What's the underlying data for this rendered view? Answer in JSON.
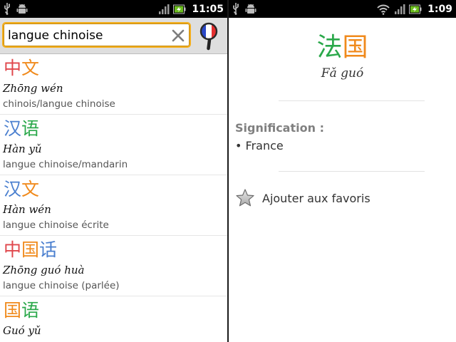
{
  "status_left": {
    "time": "11:05"
  },
  "status_right": {
    "time": "1:09"
  },
  "search": {
    "value": "langue chinoise"
  },
  "results": [
    {
      "chars": [
        "中",
        "文"
      ],
      "colors": [
        "#e0474c",
        "#f08a1c"
      ],
      "pinyin": "Zhōng wén",
      "meaning": "chinois/langue chinoise"
    },
    {
      "chars": [
        "汉",
        "语"
      ],
      "colors": [
        "#4a7fcf",
        "#2aa84a"
      ],
      "pinyin": "Hàn yǔ",
      "meaning": "langue chinoise/mandarin"
    },
    {
      "chars": [
        "汉",
        "文"
      ],
      "colors": [
        "#4a7fcf",
        "#f08a1c"
      ],
      "pinyin": "Hàn wén",
      "meaning": "langue chinoise écrite"
    },
    {
      "chars": [
        "中",
        "国",
        "话"
      ],
      "colors": [
        "#e0474c",
        "#f08a1c",
        "#4a7fcf"
      ],
      "pinyin": "Zhōng guó huà",
      "meaning": "langue chinoise (parlée)"
    },
    {
      "chars": [
        "国",
        "语"
      ],
      "colors": [
        "#f08a1c",
        "#2aa84a"
      ],
      "pinyin": "Guó yǔ",
      "meaning": ""
    }
  ],
  "detail": {
    "chars": [
      "法",
      "国"
    ],
    "colors": [
      "#2aa84a",
      "#f08a1c"
    ],
    "pinyin": "Fǎ guó",
    "signification_label": "Signification :",
    "signification_value": "• France",
    "favorite_label": "Ajouter aux favoris"
  },
  "icons": {
    "usb": "usb-icon",
    "android": "android-icon",
    "signal": "signal-icon",
    "battery": "battery-charging-icon",
    "wifi": "wifi-icon",
    "clear": "clear-icon",
    "search": "search-french-flag-icon",
    "star": "star-icon"
  },
  "colors": {
    "search_border": "#f3ad1b"
  }
}
